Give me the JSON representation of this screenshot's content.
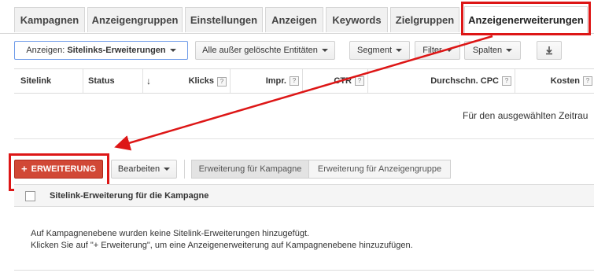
{
  "tabs": [
    {
      "label": "Kampagnen",
      "active": false
    },
    {
      "label": "Anzeigengruppen",
      "active": false
    },
    {
      "label": "Einstellungen",
      "active": false
    },
    {
      "label": "Anzeigen",
      "active": false
    },
    {
      "label": "Keywords",
      "active": false
    },
    {
      "label": "Zielgruppen",
      "active": false
    },
    {
      "label": "Anzeigenerweiterungen",
      "active": true
    }
  ],
  "toolbar": {
    "view_select": "Anzeigen: Sitelinks-Erweiterungen",
    "filter_entities": "Alle außer gelöschte Entitäten",
    "segment": "Segment",
    "filter": "Filter",
    "columns": "Spalten",
    "download_icon": "download-icon"
  },
  "table": {
    "columns": [
      "Sitelink",
      "Status",
      "Klicks",
      "Impr.",
      "CTR",
      "Durchschn. CPC",
      "Kosten"
    ],
    "sort_icon": "sort-arrow-down-icon",
    "help_glyph": "?",
    "empty_message": "Für den ausgewählten Zeitrau"
  },
  "actions": {
    "add_button": "ERWEITERUNG",
    "add_icon": "plus-icon",
    "edit_button": "Bearbeiten",
    "segment_campaign": "Erweiterung für Kampagne",
    "segment_adgroup": "Erweiterung für Anzeigengruppe"
  },
  "campaign_section": {
    "title": "Sitelink-Erweiterung für die Kampagne",
    "message_line1": "Auf Kampagnenebene wurden keine Sitelink-Erweiterungen hinzugefügt.",
    "message_line2": "Klicken Sie auf \"+ Erweiterung\", um eine Anzeigenerweiterung auf Kampagnenebene hinzuzufügen."
  },
  "colors": {
    "highlight": "#dd1616",
    "primary_button": "#d14836"
  }
}
